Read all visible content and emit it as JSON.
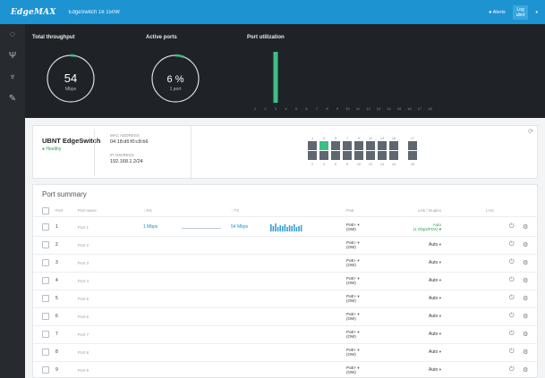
{
  "header": {
    "logo": "EdgeMAX",
    "device_title": "EdgeSwitch 16 150W",
    "alerts": "● Alerts",
    "user_line1": "Log",
    "user_line2": "ubnt"
  },
  "sidebar": {
    "items": [
      {
        "icon": "dashboard-icon",
        "glyph": "◌"
      },
      {
        "icon": "ports-icon",
        "glyph": "Ψ"
      },
      {
        "icon": "network-icon",
        "glyph": "♆"
      },
      {
        "icon": "tools-icon",
        "glyph": "✎"
      }
    ]
  },
  "dashboard": {
    "throughput": {
      "title": "Total throughput",
      "value": "54",
      "unit": "Mbps",
      "fill": 0.03
    },
    "active_ports": {
      "title": "Active ports",
      "value": "6 %",
      "unit": "1 port",
      "fill": 0.06
    },
    "port_utilization": {
      "title": "Port utilization",
      "ports": [
        "1",
        "2",
        "3",
        "4",
        "5",
        "6",
        "7",
        "8",
        "9",
        "10",
        "11",
        "12",
        "13",
        "14",
        "15",
        "16",
        "17",
        "18"
      ],
      "values": [
        0,
        0,
        95,
        0,
        0,
        0,
        0,
        0,
        0,
        0,
        0,
        0,
        0,
        0,
        0,
        0,
        0,
        0
      ]
    }
  },
  "info": {
    "switch_name": "UBNT EdgeSwitch",
    "status": "● Healthy",
    "mac_label": "MAC ADDRESS",
    "mac_value": "04:18:d6:f0:c8:b6",
    "ip_label": "IP ADDRESS",
    "ip_value": "192.168.1.2/24",
    "top_port_labels": [
      "1",
      "3",
      "5",
      "7",
      "9",
      "11",
      "13",
      "15",
      "17"
    ],
    "bottom_port_labels": [
      "2",
      "4",
      "6",
      "8",
      "10",
      "12",
      "14",
      "16",
      "18"
    ],
    "active_port": 3
  },
  "summary": {
    "title": "Port summary",
    "columns": {
      "port": "Port",
      "name": "Port name",
      "rx": "↓ RX",
      "tx": "↑ TX",
      "poe": "PoE",
      "speed": "Link / Duplex",
      "lag": "LAG"
    },
    "rows": [
      {
        "port": "1",
        "name": "Port 1",
        "rx": "1 Mbps",
        "tx": "54 Mbps",
        "poe1": "PoE+",
        "poe2": "(OW)",
        "speed": "Auto",
        "speed_sub": "(1 Gbps/FDX)",
        "active": true
      },
      {
        "port": "2",
        "name": "Port 2",
        "rx": "",
        "tx": "",
        "poe1": "PoE+",
        "poe2": "(OW)",
        "speed": "Auto",
        "speed_sub": "",
        "active": false
      },
      {
        "port": "3",
        "name": "Port 3",
        "rx": "",
        "tx": "",
        "poe1": "PoE+",
        "poe2": "(OW)",
        "speed": "Auto",
        "speed_sub": "",
        "active": false
      },
      {
        "port": "4",
        "name": "Port 4",
        "rx": "",
        "tx": "",
        "poe1": "PoE+",
        "poe2": "(OW)",
        "speed": "Auto",
        "speed_sub": "",
        "active": false
      },
      {
        "port": "5",
        "name": "Port 5",
        "rx": "",
        "tx": "",
        "poe1": "PoE+",
        "poe2": "(OW)",
        "speed": "Auto",
        "speed_sub": "",
        "active": false
      },
      {
        "port": "6",
        "name": "Port 6",
        "rx": "",
        "tx": "",
        "poe1": "PoE+",
        "poe2": "(OW)",
        "speed": "Auto",
        "speed_sub": "",
        "active": false
      },
      {
        "port": "7",
        "name": "Port 7",
        "rx": "",
        "tx": "",
        "poe1": "PoE+",
        "poe2": "(OW)",
        "speed": "Auto",
        "speed_sub": "",
        "active": false
      },
      {
        "port": "8",
        "name": "Port 8",
        "rx": "",
        "tx": "",
        "poe1": "PoE+",
        "poe2": "(OW)",
        "speed": "Auto",
        "speed_sub": "",
        "active": false
      },
      {
        "port": "9",
        "name": "Port 9",
        "rx": "",
        "tx": "",
        "poe1": "PoE+",
        "poe2": "(OW)",
        "speed": "Auto",
        "speed_sub": "",
        "active": false
      }
    ]
  },
  "colors": {
    "brand": "#1d93d2",
    "accent_green": "#3dbf86",
    "status_green": "#27a15a",
    "dark_panel": "#1f2327",
    "port_idle": "#5f6770"
  }
}
